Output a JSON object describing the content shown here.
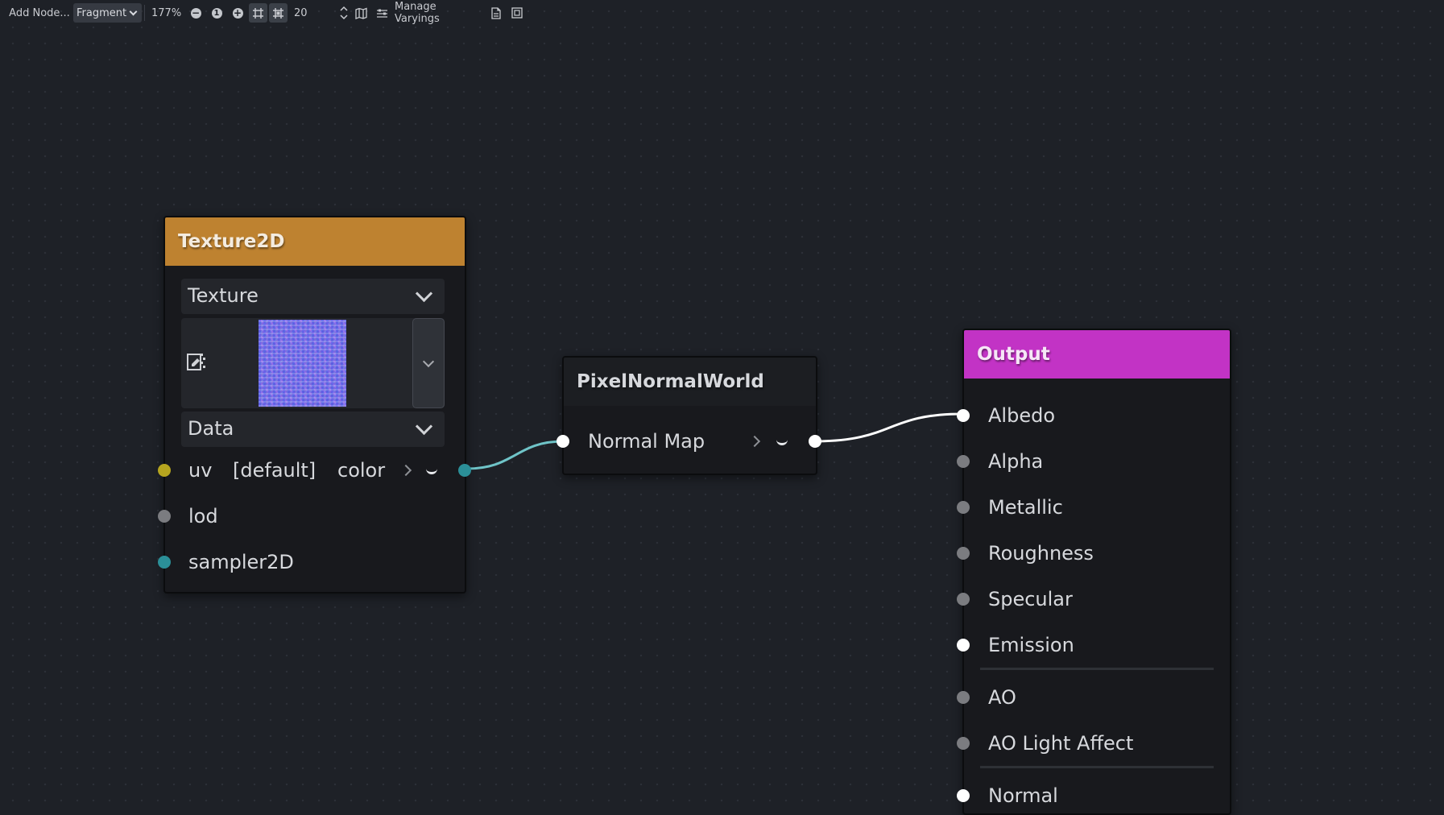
{
  "toolbar": {
    "add_node": "Add Node...",
    "mode": "Fragment",
    "zoom": "177%",
    "reset_zoom_icon": "1",
    "snap_distance": "20",
    "manage_varyings": "Manage Varyings"
  },
  "nodes": {
    "texture2d": {
      "title": "Texture2D",
      "source_select": "Texture",
      "type_select": "Data",
      "input_uv": "uv",
      "uv_default": "[default]",
      "output_color": "color",
      "input_lod": "lod",
      "input_sampler": "sampler2D"
    },
    "pixel_normal_world": {
      "title": "PixelNormalWorld",
      "input_normal_map": "Normal Map"
    },
    "output": {
      "title": "Output",
      "ports": [
        "Albedo",
        "Alpha",
        "Metallic",
        "Roughness",
        "Specular",
        "Emission",
        "AO",
        "AO Light Affect",
        "Normal"
      ]
    }
  },
  "colors": {
    "texture2d_header": "#be8230",
    "pixel_normal_world_header": "#1c1e22",
    "output_header": "#c233c5",
    "background": "#1e2127",
    "port_uv": "#b6a51f",
    "port_sampler": "#2b8f98",
    "port_default": "#ffffff",
    "port_inactive": "#7b7c80",
    "wire_teal": "#6fc4c8",
    "wire_white": "#ffffff"
  },
  "icons": [
    "minus-circle-icon",
    "reset-zoom-icon",
    "plus-circle-icon",
    "grid-icon",
    "snap-grid-icon",
    "spinner-arrows-icon",
    "minimap-icon",
    "arrange-nodes-icon",
    "file-icon",
    "preview-window-icon",
    "edit-texture-icon"
  ]
}
